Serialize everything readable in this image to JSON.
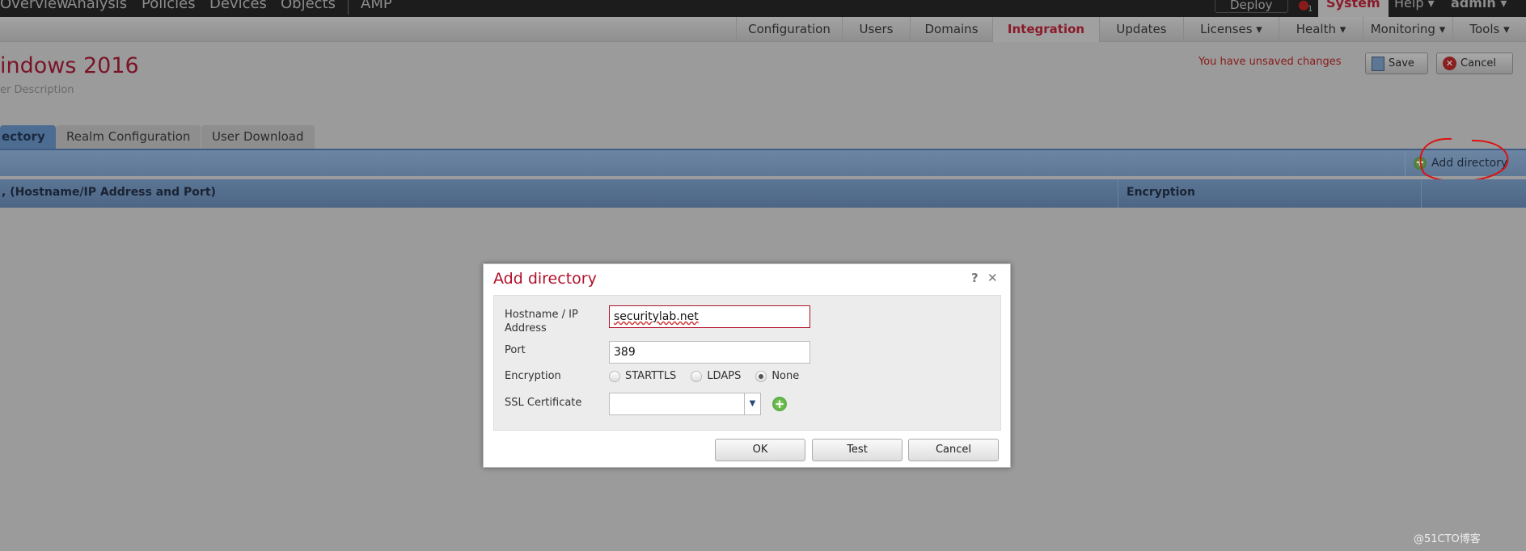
{
  "topnav": {
    "items": [
      "Overview",
      "Analysis",
      "Policies",
      "Devices",
      "Objects",
      "AMP"
    ],
    "deploy": "Deploy",
    "alert_count": "1",
    "system": "System",
    "help": "Help ▾",
    "user": "admin ▾"
  },
  "subnav": [
    "Configuration",
    "Users",
    "Domains",
    "Integration",
    "Updates",
    "Licenses ▾",
    "Health ▾",
    "Monitoring ▾",
    "Tools ▾"
  ],
  "page": {
    "title": "indows 2016",
    "description": "er Description",
    "unsaved": "You have unsaved changes",
    "save": "Save",
    "cancel": "Cancel"
  },
  "tabs": [
    "ectory",
    "Realm Configuration",
    "User Download"
  ],
  "toolbar": {
    "add_directory": "Add directory"
  },
  "table": {
    "columns": [
      ", (Hostname/IP Address and Port)",
      "Encryption"
    ]
  },
  "dialog": {
    "title": "Add directory",
    "help": "?",
    "close": "✕",
    "hostname_label": "Hostname / IP Address",
    "hostname_value": "securitylab.net",
    "port_label": "Port",
    "port_value": "389",
    "encryption_label": "Encryption",
    "encryption_options": [
      "STARTTLS",
      "LDAPS",
      "None"
    ],
    "encryption_selected": "None",
    "ssl_label": "SSL Certificate",
    "ssl_value": "",
    "ok": "OK",
    "test": "Test",
    "cancel": "Cancel"
  },
  "watermark": "@51CTO博客"
}
